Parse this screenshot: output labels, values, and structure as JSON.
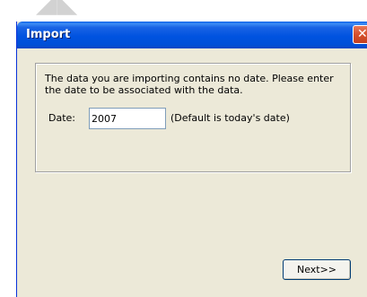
{
  "window": {
    "title": "Import",
    "close_glyph": "✕"
  },
  "body": {
    "message": "The data you are importing contains no date.  Please enter the date to be associated with the data."
  },
  "date_field": {
    "label": "Date:",
    "value": "2007",
    "hint": "(Default is today's date)"
  },
  "buttons": {
    "next_label": "Next>>"
  },
  "colors": {
    "titlebar": "#0053e0",
    "dialog_face": "#ece9d8",
    "close_button": "#d7502c"
  },
  "icons": {
    "close": "close-icon"
  }
}
